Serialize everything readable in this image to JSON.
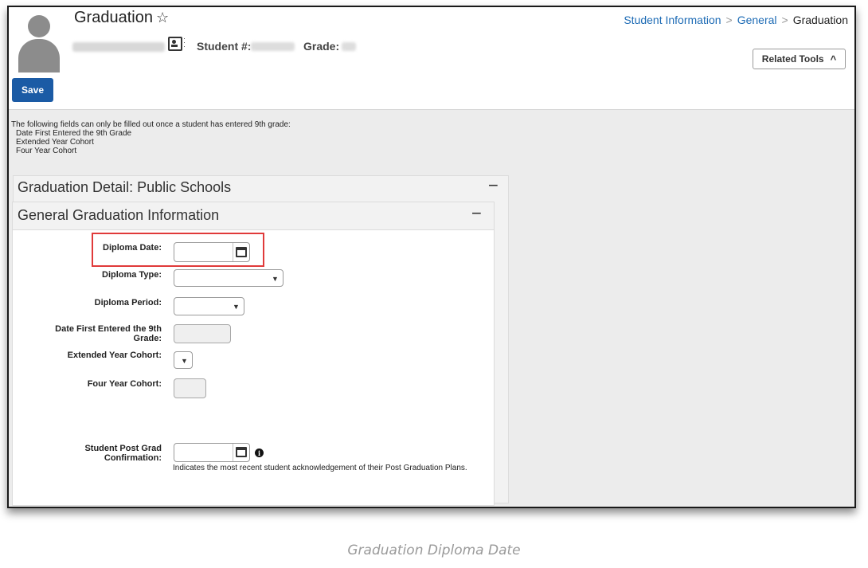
{
  "header": {
    "title": "Graduation",
    "star_icon": "☆",
    "student_label": "Student #:",
    "grade_label": "Grade:",
    "breadcrumb": [
      "Student Information",
      "General",
      "Graduation"
    ],
    "breadcrumb_sep": ">",
    "related_tools": "Related Tools",
    "related_tools_icon": "^"
  },
  "toolbar": {
    "save_label": "Save"
  },
  "notice": {
    "intro": "The following fields can only be filled out once a student has entered 9th grade:",
    "items": [
      "Date First Entered the 9th Grade",
      "Extended Year Cohort",
      "Four Year Cohort"
    ]
  },
  "panels": {
    "outer_title": "Graduation Detail: Public Schools",
    "inner_title": "General Graduation Information",
    "collapse_icon": "−"
  },
  "form": {
    "diploma_date": {
      "label": "Diploma Date:",
      "value": ""
    },
    "diploma_type": {
      "label": "Diploma Type:",
      "value": ""
    },
    "diploma_period": {
      "label": "Diploma Period:",
      "value": ""
    },
    "date_first_entered": {
      "label_line1": "Date First Entered the 9th",
      "label_line2": "Grade:",
      "value": ""
    },
    "extended_year_cohort": {
      "label": "Extended Year Cohort:",
      "value": ""
    },
    "four_year_cohort": {
      "label": "Four Year Cohort:",
      "value": ""
    },
    "post_grad": {
      "label_line1": "Student Post Grad",
      "label_line2": "Confirmation:",
      "value": "",
      "info_icon": "i",
      "help": "Indicates the most recent student acknowledgement of their Post Graduation Plans."
    }
  },
  "caption": "Graduation Diploma Date",
  "colors": {
    "primary": "#1b5ba5",
    "link": "#1d6bb5",
    "highlight": "#e03a3a"
  }
}
